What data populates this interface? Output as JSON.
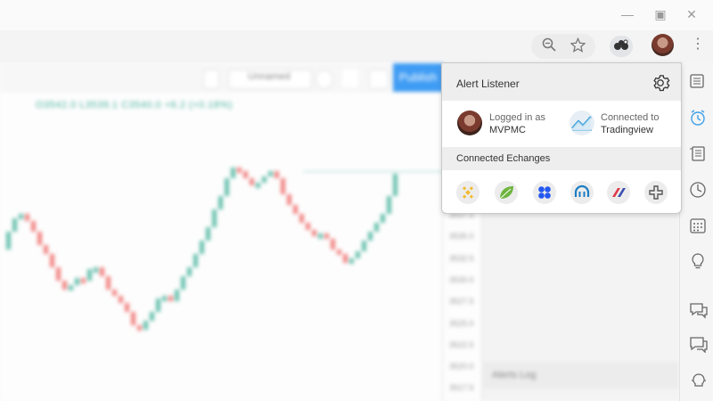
{
  "window": {
    "minimize_icon": "minimize-icon",
    "maximize_icon": "restore-icon",
    "close_icon": "close-icon"
  },
  "browser_toolbar": {
    "icons": [
      "zoom-icon",
      "star-icon",
      "extension-icon",
      "profile-avatar",
      "menu-kebab-icon"
    ]
  },
  "tradingview": {
    "toolbar": {
      "layout_name": "Unnamed",
      "publish_label": "Publish"
    },
    "ohlc_text": "O3542.0 L3539.1 C3540.0 +6.2 (+0.18%)",
    "price_ticks": [
      "3537.5",
      "3535.0",
      "3532.5",
      "3530.0",
      "3527.5",
      "3525.0",
      "3522.5",
      "3520.0",
      "3517.5"
    ],
    "alerts_log_label": "Alerts Log",
    "colors": {
      "up": "#4db6a0",
      "down": "#ef6f6c",
      "publish": "#3f9cf4"
    }
  },
  "popup": {
    "title": "Alert Listener",
    "settings_icon": "gear-icon",
    "user": {
      "status_label": "Logged in as",
      "username": "MVPMC"
    },
    "connection": {
      "status_label": "Connected to",
      "service": "Tradingview"
    },
    "exchanges_title": "Connected Echanges",
    "exchanges": [
      {
        "name": "binance-icon",
        "color": "#f3ba2f"
      },
      {
        "name": "bitfinex-icon",
        "color": "#6eb43f"
      },
      {
        "name": "coinbase-icon",
        "color": "#2458f0"
      },
      {
        "name": "kraken-icon",
        "color": "#1d7dc3"
      },
      {
        "name": "bitmex-icon",
        "color": "#e0384b"
      },
      {
        "name": "add-exchange-icon",
        "color": "#666666"
      }
    ]
  },
  "sidebar": {
    "icons": [
      "watchlist-icon",
      "alarm-clock-icon",
      "data-window-icon",
      "clock-icon",
      "calendar-icon",
      "lightbulb-icon",
      "chat-icon",
      "chats-icon",
      "ideas-icon"
    ]
  }
}
